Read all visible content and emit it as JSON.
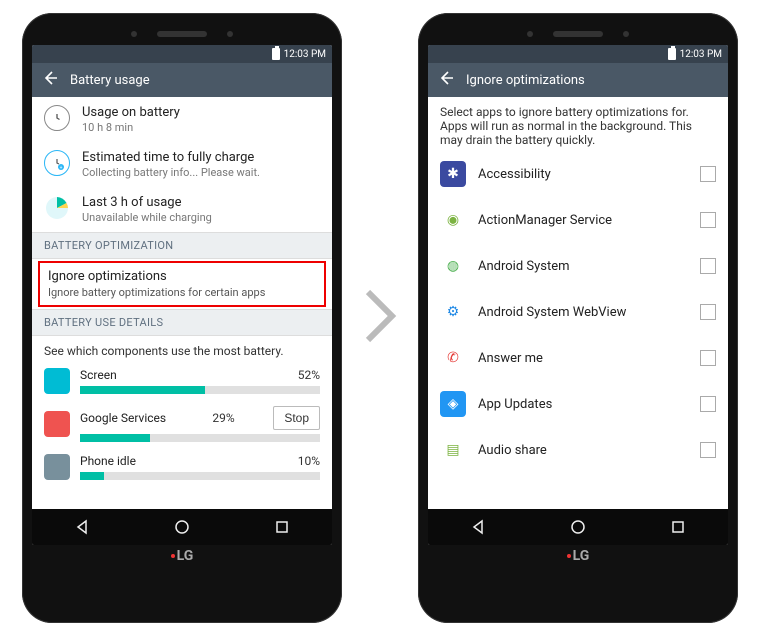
{
  "statusbar": {
    "time": "12:03 PM"
  },
  "left": {
    "appbar_title": "Battery usage",
    "usage_on_battery": {
      "title": "Usage on battery",
      "sub": "10 h 8 min"
    },
    "estimated": {
      "title": "Estimated time to fully charge",
      "sub": "Collecting battery info... Please wait."
    },
    "last3h": {
      "title": "Last 3 h of usage",
      "sub": "Unavailable while charging"
    },
    "section_opt": "BATTERY OPTIMIZATION",
    "ignore_opt": {
      "title": "Ignore optimizations",
      "sub": "Ignore battery optimizations for certain apps"
    },
    "section_details": "BATTERY USE DETAILS",
    "details_desc": "See which components use the most battery.",
    "components": [
      {
        "name": "Screen",
        "pct": "52%",
        "fill": 52
      },
      {
        "name": "Google Services",
        "pct": "29%",
        "fill": 29
      },
      {
        "name": "Phone idle",
        "pct": "10%",
        "fill": 10
      }
    ],
    "stop_label": "Stop"
  },
  "right": {
    "appbar_title": "Ignore optimizations",
    "desc": "Select apps to ignore battery optimizations for. Apps will run as normal in the background. This may drain the battery quickly.",
    "apps": [
      {
        "name": "Accessibility",
        "icon_bg": "#3b4aa0",
        "icon_fg": "#fff",
        "glyph": "✱"
      },
      {
        "name": "ActionManager Service",
        "icon_bg": "#fff",
        "icon_fg": "#7cb342",
        "glyph": "◉"
      },
      {
        "name": "Android System",
        "icon_bg": "#fff",
        "icon_fg": "#4caf50",
        "glyph": "◍"
      },
      {
        "name": "Android System WebView",
        "icon_bg": "#fff",
        "icon_fg": "#1e88e5",
        "glyph": "⚙"
      },
      {
        "name": "Answer me",
        "icon_bg": "#fff",
        "icon_fg": "#e53935",
        "glyph": "✆"
      },
      {
        "name": "App Updates",
        "icon_bg": "#2196f3",
        "icon_fg": "#fff",
        "glyph": "◈"
      },
      {
        "name": "Audio share",
        "icon_bg": "#fff",
        "icon_fg": "#7cb342",
        "glyph": "▤"
      }
    ]
  },
  "brand": "LG"
}
